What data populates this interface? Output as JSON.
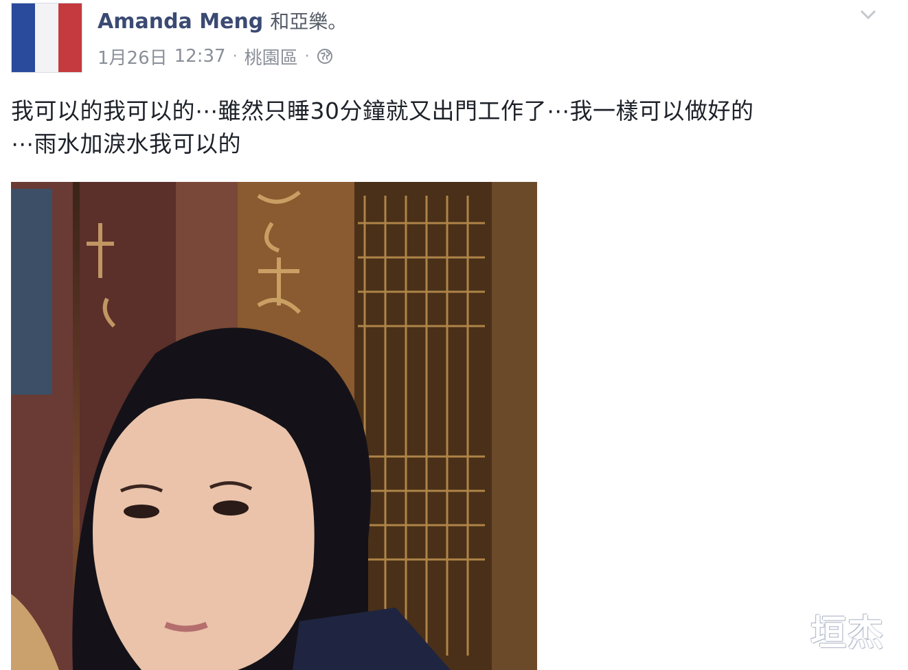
{
  "post": {
    "author": "Amanda Meng",
    "with_text": "和亞樂。",
    "date": "1月26日",
    "time": "12:37",
    "separator": "·",
    "location": "桃園區",
    "audience_icon": "globe-icon",
    "menu_icon": "chevron-down-icon",
    "body": "我可以的我可以的⋯雖然只睡30分鐘就又出門工作了⋯我一樣可以做好的\n⋯雨水加淚水我可以的"
  },
  "avatar": {
    "flag_colors": [
      "#2a4a9c",
      "#f3f3f6",
      "#c53a3f"
    ]
  },
  "photo": {
    "description_icon": "photo-image"
  },
  "watermark": {
    "text": "垣杰"
  }
}
